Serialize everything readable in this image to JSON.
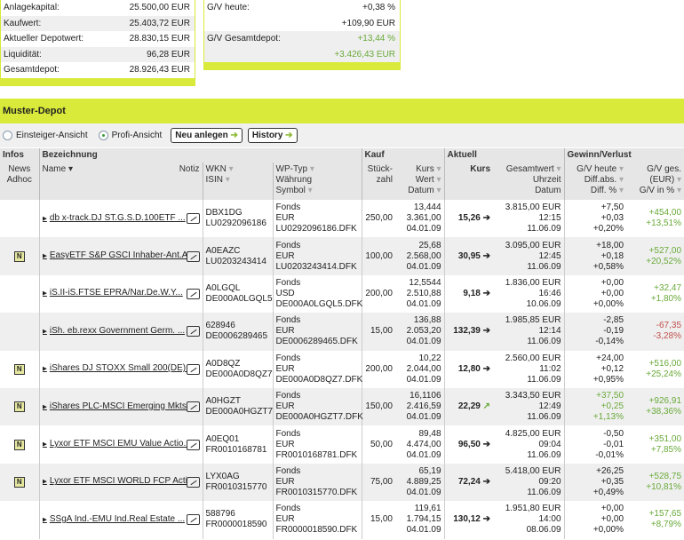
{
  "summary_left": [
    {
      "label": "Anlagekapital:",
      "value": "25.500,00 EUR"
    },
    {
      "label": "Kaufwert:",
      "value": "25.403,72 EUR"
    },
    {
      "label": "Aktueller Depotwert:",
      "value": "28.830,15 EUR"
    },
    {
      "label": "Liquidität:",
      "value": "96,28 EUR"
    },
    {
      "label": "Gesamtdepot:",
      "value": "28.926,43 EUR"
    }
  ],
  "summary_right": {
    "gv_heute_label": "G/V heute:",
    "gv_heute_pct": "+0,38 %",
    "gv_heute_eur": "+109,90 EUR",
    "gv_ges_label": "G/V Gesamtdepot:",
    "gv_ges_pct": "+13,44 %",
    "gv_ges_eur": "+3.426,43 EUR"
  },
  "depot_title": "Muster-Depot",
  "toolbar": {
    "einsteiger": "Einsteiger-Ansicht",
    "profi": "Profi-Ansicht",
    "neu": "Neu anlegen",
    "history": "History",
    "arrow": "➔"
  },
  "headers": {
    "infos": "Infos",
    "bezeichnung": "Bezeichnung",
    "kauf": "Kauf",
    "aktuell": "Aktuell",
    "gv": "Gewinn/Verlust",
    "news": "News",
    "adhoc": "Adhoc",
    "name": "Name ▾",
    "notiz": "Notiz",
    "wkn": "WKN",
    "isin": "ISIN",
    "wptyp": "WP-Typ",
    "waehrung": "Währung",
    "symbol": "Symbol",
    "stueck": "Stück-",
    "zahl": "zahl",
    "kurs": "Kurs",
    "wert": "Wert",
    "datum": "Datum",
    "akurs": "Kurs",
    "gesamtwert": "Gesamtwert",
    "uhrzeit": "Uhrzeit",
    "adatum": "Datum",
    "gvheute": "G/V heute",
    "diffabs": "Diff.abs.",
    "diffpct": "Diff. %",
    "gvges": "G/V ges.",
    "eur": "(EUR)",
    "gvinpct": "G/V in %",
    "sort": "▾"
  },
  "news_badge": "N",
  "rows": [
    {
      "news": false,
      "name": "db x-track.DJ ST.G.S.D.100ETF ...",
      "wkn": "DBX1DG",
      "isin": "LU0292096186",
      "typ": "Fonds",
      "cur": "EUR",
      "sym": "LU0292096186.DFK",
      "stueck": "250,00",
      "kkurs": "13,444",
      "kwert": "3.361,00",
      "kdatum": "04.01.09",
      "akurs": "15,26",
      "trend": "➔",
      "gesamt": "3.815,00 EUR",
      "zeit": "12:15",
      "adatum": "11.06.09",
      "gvh": "+7,50",
      "diff": "+0,03",
      "diffp": "+0,20%",
      "gvh_color": "",
      "gves": "+454,00",
      "gvp": "+13,51%",
      "gv_color": "grn"
    },
    {
      "news": true,
      "name": "EasyETF S&P GSCI Inhaber-Ant.A...",
      "wkn": "A0EAZC",
      "isin": "LU0203243414",
      "typ": "Fonds",
      "cur": "EUR",
      "sym": "LU0203243414.DFK",
      "stueck": "100,00",
      "kkurs": "25,68",
      "kwert": "2.568,00",
      "kdatum": "04.01.09",
      "akurs": "30,95",
      "trend": "➔",
      "gesamt": "3.095,00 EUR",
      "zeit": "12:45",
      "adatum": "11.06.09",
      "gvh": "+18,00",
      "diff": "+0,18",
      "diffp": "+0,58%",
      "gvh_color": "",
      "gves": "+527,00",
      "gvp": "+20,52%",
      "gv_color": "grn"
    },
    {
      "news": false,
      "name": "iS.II-iS.FTSE EPRA/Nar.De.W.Y...",
      "wkn": "A0LGQL",
      "isin": "DE000A0LGQL5",
      "typ": "Fonds",
      "cur": "USD",
      "sym": "DE000A0LGQL5.DFK",
      "stueck": "200,00",
      "kkurs": "12,5544",
      "kwert": "2.510,88",
      "kdatum": "04.01.09",
      "akurs": "9,18",
      "trend": "➔",
      "gesamt": "1.836,00 EUR",
      "zeit": "16:46",
      "adatum": "10.06.09",
      "gvh": "+0,00",
      "diff": "+0,00",
      "diffp": "+0,00%",
      "gvh_color": "",
      "gves": "+32,47",
      "gvp": "+1,80%",
      "gv_color": "grn"
    },
    {
      "news": false,
      "name": "iSh. eb.rexx Government Germ. ...",
      "wkn": "628946",
      "isin": "DE0006289465",
      "typ": "Fonds",
      "cur": "EUR",
      "sym": "DE0006289465.DFK",
      "stueck": "15,00",
      "kkurs": "136,88",
      "kwert": "2.053,20",
      "kdatum": "04.01.09",
      "akurs": "132,39",
      "trend": "➔",
      "gesamt": "1.985,85 EUR",
      "zeit": "12:14",
      "adatum": "11.06.09",
      "gvh": "-2,85",
      "diff": "-0,19",
      "diffp": "-0,14%",
      "gvh_color": "",
      "gves": "-67,35",
      "gvp": "-3,28%",
      "gv_color": "red"
    },
    {
      "news": true,
      "name": "iShares DJ STOXX Small 200(DE)...",
      "wkn": "A0D8QZ",
      "isin": "DE000A0D8QZ7",
      "typ": "Fonds",
      "cur": "EUR",
      "sym": "DE000A0D8QZ7.DFK",
      "stueck": "200,00",
      "kkurs": "10,22",
      "kwert": "2.044,00",
      "kdatum": "04.01.09",
      "akurs": "12,80",
      "trend": "➔",
      "gesamt": "2.560,00 EUR",
      "zeit": "11:02",
      "adatum": "11.06.09",
      "gvh": "+24,00",
      "diff": "+0,12",
      "diffp": "+0,95%",
      "gvh_color": "",
      "gves": "+516,00",
      "gvp": "+25,24%",
      "gv_color": "grn"
    },
    {
      "news": true,
      "name": "iShares PLC-MSCI Emerging Mkts...",
      "wkn": "A0HGZT",
      "isin": "DE000A0HGZT7",
      "typ": "Fonds",
      "cur": "EUR",
      "sym": "DE000A0HGZT7.DFK",
      "stueck": "150,00",
      "kkurs": "16,1106",
      "kwert": "2.416,59",
      "kdatum": "04.01.09",
      "akurs": "22,29",
      "trend": "↗",
      "gesamt": "3.343,50 EUR",
      "zeit": "12:49",
      "adatum": "11.06.09",
      "gvh": "+37,50",
      "diff": "+0,25",
      "diffp": "+1,13%",
      "gvh_color": "grn",
      "gves": "+926,91",
      "gvp": "+38,36%",
      "gv_color": "grn"
    },
    {
      "news": true,
      "name": "Lyxor ETF MSCI EMU Value Actio...",
      "wkn": "A0EQ01",
      "isin": "FR0010168781",
      "typ": "Fonds",
      "cur": "EUR",
      "sym": "FR0010168781.DFK",
      "stueck": "50,00",
      "kkurs": "89,48",
      "kwert": "4.474,00",
      "kdatum": "04.01.09",
      "akurs": "96,50",
      "trend": "➔",
      "gesamt": "4.825,00 EUR",
      "zeit": "09:04",
      "adatum": "11.06.09",
      "gvh": "-0,50",
      "diff": "-0,01",
      "diffp": "-0,01%",
      "gvh_color": "",
      "gves": "+351,00",
      "gvp": "+7,85%",
      "gv_color": "grn"
    },
    {
      "news": true,
      "name": "Lyxor ETF MSCI WORLD FCP Actio...",
      "wkn": "LYX0AG",
      "isin": "FR0010315770",
      "typ": "Fonds",
      "cur": "EUR",
      "sym": "FR0010315770.DFK",
      "stueck": "75,00",
      "kkurs": "65,19",
      "kwert": "4.889,25",
      "kdatum": "04.01.09",
      "akurs": "72,24",
      "trend": "➔",
      "gesamt": "5.418,00 EUR",
      "zeit": "09:20",
      "adatum": "11.06.09",
      "gvh": "+26,25",
      "diff": "+0,35",
      "diffp": "+0,49%",
      "gvh_color": "",
      "gves": "+528,75",
      "gvp": "+10,81%",
      "gv_color": "grn"
    },
    {
      "news": false,
      "name": "SSgA Ind.-EMU Ind.Real Estate ...",
      "wkn": "588796",
      "isin": "FR0000018590",
      "typ": "Fonds",
      "cur": "EUR",
      "sym": "FR0000018590.DFK",
      "stueck": "15,00",
      "kkurs": "119,61",
      "kwert": "1.794,15",
      "kdatum": "04.01.09",
      "akurs": "130,12",
      "trend": "➔",
      "gesamt": "1.951,80 EUR",
      "zeit": "14:00",
      "adatum": "08.06.09",
      "gvh": "+0,00",
      "diff": "+0,00",
      "diffp": "+0,00%",
      "gvh_color": "",
      "gves": "+157,65",
      "gvp": "+8,79%",
      "gv_color": "grn"
    }
  ]
}
